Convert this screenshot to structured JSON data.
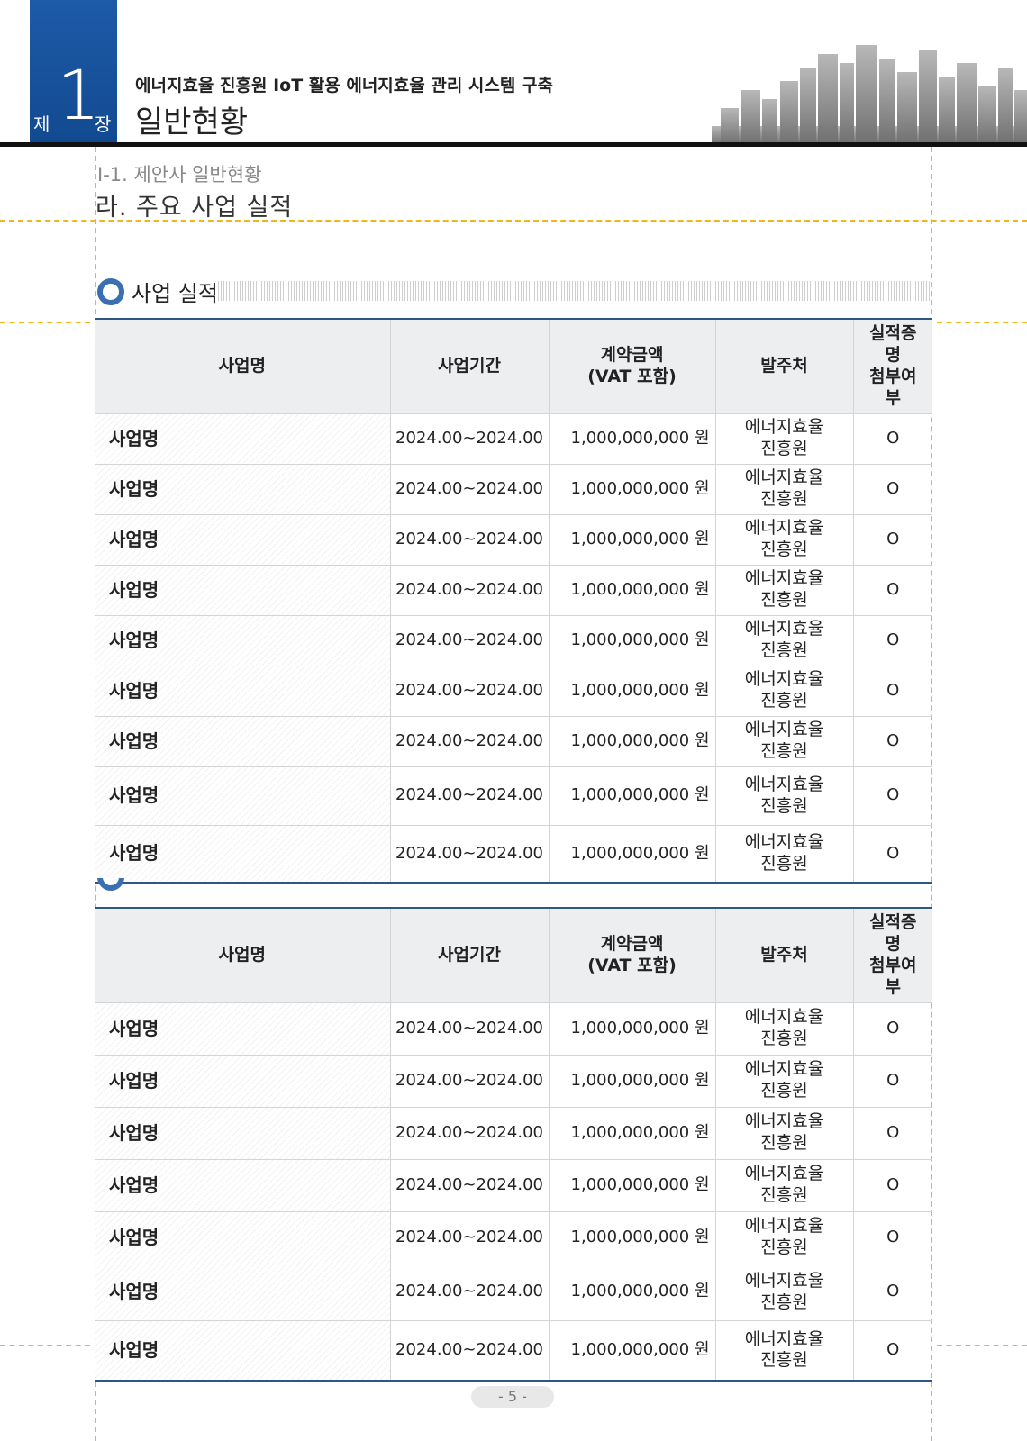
{
  "header": {
    "chapter_prefix": "제",
    "chapter_number": "1",
    "chapter_suffix": "장",
    "doc_subtitle": "에너지효율 진흥원   IoT 활용 에너지효율 관리 시스템 구축",
    "chapter_title": "일반현황"
  },
  "breadcrumb": "Ⅰ-1. 제안사 일반현황",
  "section_title": "라. 주요 사업 실적",
  "subsection_title": "사업 실적",
  "table_headers": {
    "name": "사업명",
    "period": "사업기간",
    "amount_line1": "계약금액",
    "amount_line2": "(VAT 포함)",
    "client": "발주처",
    "proof_line1": "실적증",
    "proof_line2": "명",
    "proof_line3": "첨부여",
    "proof_line4": "부"
  },
  "table1": {
    "rows": [
      {
        "name": "사업명",
        "period": "2024.00~2024.00",
        "amount": "1,000,000,000 원",
        "client_line1": "에너지효율",
        "client_line2": "진흥원",
        "proof": "O"
      },
      {
        "name": "사업명",
        "period": "2024.00~2024.00",
        "amount": "1,000,000,000 원",
        "client_line1": "에너지효율",
        "client_line2": "진흥원",
        "proof": "O"
      },
      {
        "name": "사업명",
        "period": "2024.00~2024.00",
        "amount": "1,000,000,000 원",
        "client_line1": "에너지효율",
        "client_line2": "진흥원",
        "proof": "O"
      },
      {
        "name": "사업명",
        "period": "2024.00~2024.00",
        "amount": "1,000,000,000 원",
        "client_line1": "에너지효율",
        "client_line2": "진흥원",
        "proof": "O"
      },
      {
        "name": "사업명",
        "period": "2024.00~2024.00",
        "amount": "1,000,000,000 원",
        "client_line1": "에너지효율",
        "client_line2": "진흥원",
        "proof": "O"
      },
      {
        "name": "사업명",
        "period": "2024.00~2024.00",
        "amount": "1,000,000,000 원",
        "client_line1": "에너지효율",
        "client_line2": "진흥원",
        "proof": "O"
      },
      {
        "name": "사업명",
        "period": "2024.00~2024.00",
        "amount": "1,000,000,000 원",
        "client_line1": "에너지효율",
        "client_line2": "진흥원",
        "proof": "O"
      },
      {
        "name": "사업명",
        "period": "2024.00~2024.00",
        "amount": "1,000,000,000 원",
        "client_line1": "에너지효율",
        "client_line2": "진흥원",
        "proof": "O"
      },
      {
        "name": "사업명",
        "period": "2024.00~2024.00",
        "amount": "1,000,000,000 원",
        "client_line1": "에너지효율",
        "client_line2": "진흥원",
        "proof": "O"
      }
    ]
  },
  "table2": {
    "rows": [
      {
        "name": "사업명",
        "period": "2024.00~2024.00",
        "amount": "1,000,000,000 원",
        "client_line1": "에너지효율",
        "client_line2": "진흥원",
        "proof": "O"
      },
      {
        "name": "사업명",
        "period": "2024.00~2024.00",
        "amount": "1,000,000,000 원",
        "client_line1": "에너지효율",
        "client_line2": "진흥원",
        "proof": "O"
      },
      {
        "name": "사업명",
        "period": "2024.00~2024.00",
        "amount": "1,000,000,000 원",
        "client_line1": "에너지효율",
        "client_line2": "진흥원",
        "proof": "O"
      },
      {
        "name": "사업명",
        "period": "2024.00~2024.00",
        "amount": "1,000,000,000 원",
        "client_line1": "에너지효율",
        "client_line2": "진흥원",
        "proof": "O"
      },
      {
        "name": "사업명",
        "period": "2024.00~2024.00",
        "amount": "1,000,000,000 원",
        "client_line1": "에너지효율",
        "client_line2": "진흥원",
        "proof": "O"
      },
      {
        "name": "사업명",
        "period": "2024.00~2024.00",
        "amount": "1,000,000,000 원",
        "client_line1": "에너지효율",
        "client_line2": "진흥원",
        "proof": "O"
      },
      {
        "name": "사업명",
        "period": "2024.00~2024.00",
        "amount": "1,000,000,000 원",
        "client_line1": "에너지효율",
        "client_line2": "진흥원",
        "proof": "O"
      }
    ]
  },
  "page_number": "- 5 -",
  "colors": {
    "chapter_blue": "#1d5aa8",
    "table_rule": "#2f5786",
    "guide_yellow": "#f1b61a",
    "header_fill": "#eceef0"
  }
}
